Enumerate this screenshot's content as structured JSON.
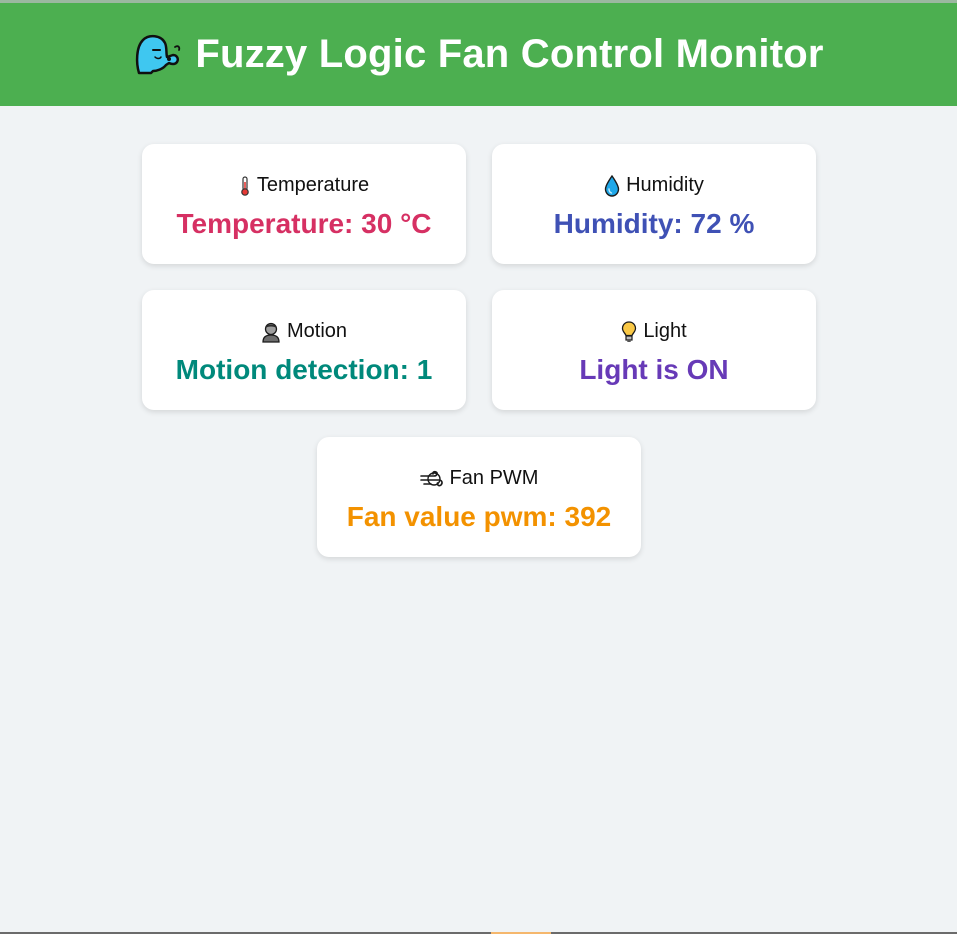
{
  "header": {
    "title": "Fuzzy Logic Fan Control Monitor",
    "icon": "blowing-face-icon"
  },
  "colors": {
    "header_bg": "#4caf50",
    "page_bg": "#f0f3f5",
    "temperature": "#d63063",
    "humidity": "#3f51b5",
    "motion": "#00897b",
    "light": "#673ab7",
    "fan": "#f39200"
  },
  "cards": {
    "temperature": {
      "label": "Temperature",
      "value": "Temperature: 30 °C",
      "icon": "thermometer-icon"
    },
    "humidity": {
      "label": "Humidity",
      "value": "Humidity: 72 %",
      "icon": "droplet-icon"
    },
    "motion": {
      "label": "Motion",
      "value": "Motion detection: 1",
      "icon": "person-icon"
    },
    "light": {
      "label": "Light",
      "value": "Light is ON",
      "icon": "light-bulb-icon"
    },
    "fan": {
      "label": "Fan PWM",
      "value": "Fan value pwm: 392",
      "icon": "wind-icon"
    }
  }
}
